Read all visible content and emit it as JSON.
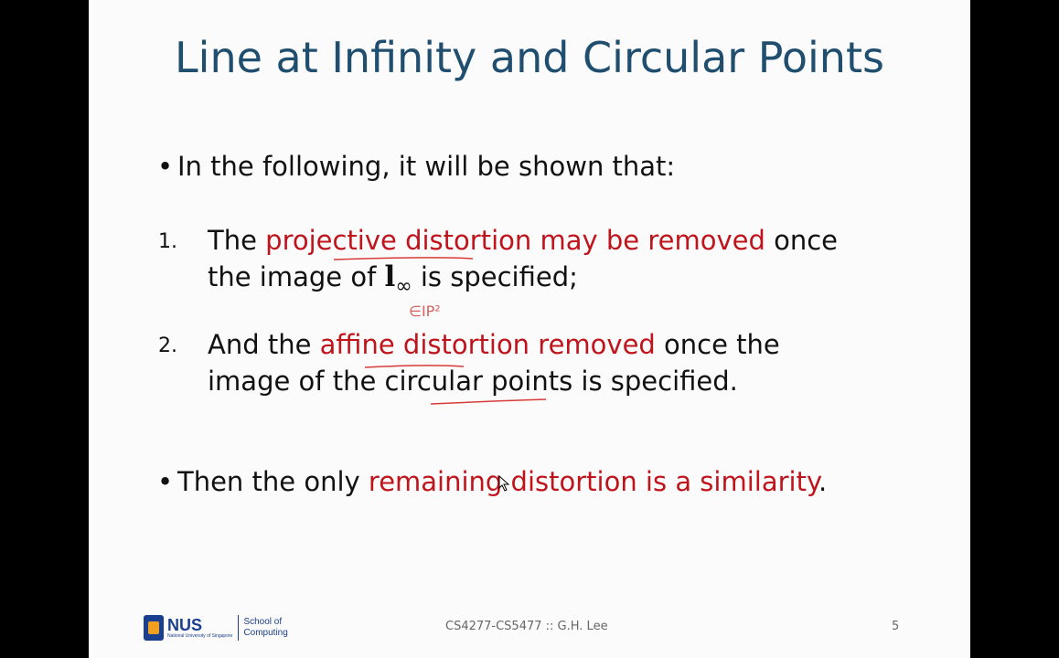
{
  "slide": {
    "title": "Line at Infinity and Circular Points",
    "intro": {
      "bullet": "•",
      "text": "In the following, it will be shown that:"
    },
    "item1": {
      "number": "1.",
      "part_red": "projective distortion may be removed",
      "part_after": " once",
      "line2_before": "the image of ",
      "symbol": "l",
      "symbol_sub": "∞",
      "line2_after": " is specified;",
      "prefix": "The "
    },
    "item2": {
      "number": "2.",
      "prefix": "And the ",
      "part_red": "affine distortion removed",
      "part_after": " once the",
      "line2": "image of the circular points is specified."
    },
    "outro": {
      "bullet": "•",
      "prefix": "Then the only ",
      "part_red": "remaining distortion is a similarity",
      "suffix": "."
    },
    "annotation_handwritten": "∈IP²",
    "footer": {
      "course": "CS4277-CS5477 :: G.H. Lee",
      "page_number": "5",
      "logo": {
        "name": "NUS",
        "subtitle": "National University of Singapore",
        "school_line1": "School of",
        "school_line2": "Computing"
      }
    },
    "colors": {
      "title": "#1f4e6e",
      "highlight_red": "#c0141c",
      "body_text": "#111111",
      "brand_blue": "#1b3f8f"
    }
  }
}
